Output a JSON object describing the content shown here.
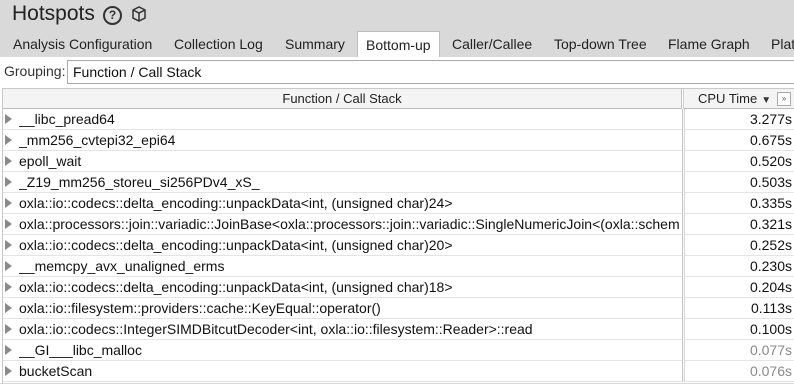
{
  "title": "Hotspots",
  "tabs": [
    {
      "label": "Analysis Configuration"
    },
    {
      "label": "Collection Log"
    },
    {
      "label": "Summary"
    },
    {
      "label": "Bottom-up",
      "active": true
    },
    {
      "label": "Caller/Callee"
    },
    {
      "label": "Top-down Tree"
    },
    {
      "label": "Flame Graph"
    },
    {
      "label": "Plat"
    }
  ],
  "grouping": {
    "label": "Grouping:",
    "value": "Function / Call Stack"
  },
  "columns": {
    "function": "Function / Call Stack",
    "cpu": "CPU Time"
  },
  "rows": [
    {
      "name": "__libc_pread64",
      "cpu": "3.277s"
    },
    {
      "name": "_mm256_cvtepi32_epi64",
      "cpu": "0.675s"
    },
    {
      "name": "epoll_wait",
      "cpu": "0.520s"
    },
    {
      "name": "_Z19_mm256_storeu_si256PDv4_xS_",
      "cpu": "0.503s"
    },
    {
      "name": "oxla::io::codecs::delta_encoding::unpackData<int, (unsigned char)24>",
      "cpu": "0.335s"
    },
    {
      "name": "oxla::processors::join::variadic::JoinBase<oxla::processors::join::variadic::SingleNumericJoin<(oxla::schem",
      "cpu": "0.321s"
    },
    {
      "name": "oxla::io::codecs::delta_encoding::unpackData<int, (unsigned char)20>",
      "cpu": "0.252s"
    },
    {
      "name": "__memcpy_avx_unaligned_erms",
      "cpu": "0.230s"
    },
    {
      "name": "oxla::io::codecs::delta_encoding::unpackData<int, (unsigned char)18>",
      "cpu": "0.204s"
    },
    {
      "name": "oxla::io::filesystem::providers::cache::KeyEqual::operator()",
      "cpu": "0.113s"
    },
    {
      "name": "oxla::io::codecs::IntegerSIMDBitcutDecoder<int, oxla::io::filesystem::Reader>::read",
      "cpu": "0.100s"
    },
    {
      "name": "__GI___libc_malloc",
      "cpu": "0.077s",
      "dim": true
    },
    {
      "name": "bucketScan",
      "cpu": "0.076s",
      "dim": true
    }
  ]
}
